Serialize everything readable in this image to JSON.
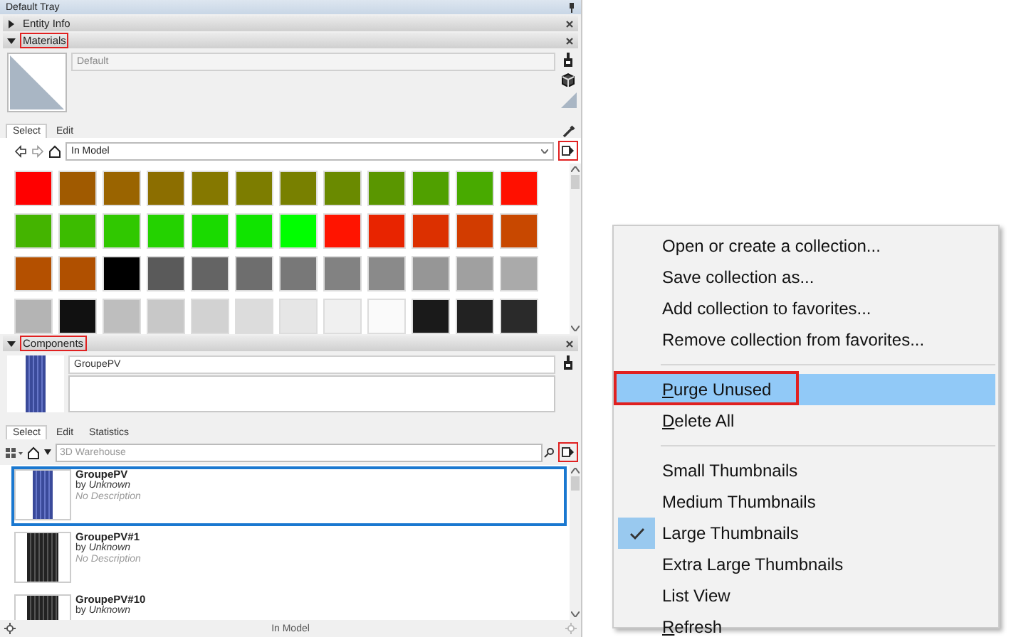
{
  "tray": {
    "title": "Default Tray"
  },
  "entity_info": {
    "title": "Entity Info",
    "expanded": false
  },
  "materials": {
    "title": "Materials",
    "expanded": true,
    "annotated": true,
    "name": "Default",
    "tabs": [
      {
        "label": "Select",
        "selected": true
      },
      {
        "label": "Edit",
        "selected": false
      }
    ],
    "collection": "In Model",
    "details_annotated": true,
    "swatches": [
      {
        "color": "#ff0000"
      },
      {
        "color": "#a05a00"
      },
      {
        "color": "#9a6400"
      },
      {
        "color": "#8c6e00"
      },
      {
        "color": "#857800"
      },
      {
        "color": "#7d7d00"
      },
      {
        "color": "#788000"
      },
      {
        "color": "#6a8a00"
      },
      {
        "color": "#5a9600"
      },
      {
        "color": "#50a000"
      },
      {
        "color": "#48aa00"
      },
      {
        "color": "#ff1000"
      },
      {
        "color": "#44b400"
      },
      {
        "color": "#3cbc00"
      },
      {
        "color": "#30c800"
      },
      {
        "color": "#24d200"
      },
      {
        "color": "#1ada00"
      },
      {
        "color": "#10e400"
      },
      {
        "color": "#00ff00"
      },
      {
        "color": "#ff1400"
      },
      {
        "color": "#e82400"
      },
      {
        "color": "#dc3000"
      },
      {
        "color": "#d23c00"
      },
      {
        "color": "#c84800"
      },
      {
        "color": "#b45000"
      },
      {
        "color": "#b05000"
      },
      {
        "color": "#000000"
      },
      {
        "color": "#5a5a5a"
      },
      {
        "color": "#646464"
      },
      {
        "color": "#6e6e6e"
      },
      {
        "color": "#787878"
      },
      {
        "color": "#828282"
      },
      {
        "color": "#8a8a8a"
      },
      {
        "color": "#969696"
      },
      {
        "color": "#a0a0a0"
      },
      {
        "color": "#aaaaaa"
      },
      {
        "color": "#b4b4b4"
      },
      {
        "color": "#111111"
      },
      {
        "color": "#bebebe"
      },
      {
        "color": "#c8c8c8"
      },
      {
        "color": "#d2d2d2"
      },
      {
        "color": "#dcdcdc"
      },
      {
        "color": "#e6e6e6"
      },
      {
        "color": "#f0f0f0"
      },
      {
        "color": "#fafafa"
      },
      {
        "color": "#1a1a1a"
      },
      {
        "color": "#222222"
      },
      {
        "color": "#2a2a2a"
      }
    ]
  },
  "components": {
    "title": "Components",
    "expanded": true,
    "annotated": true,
    "name": "GroupePV",
    "tabs": [
      {
        "label": "Select",
        "selected": true
      },
      {
        "label": "Edit",
        "selected": false
      },
      {
        "label": "Statistics",
        "selected": false
      }
    ],
    "search": {
      "placeholder": "3D Warehouse"
    },
    "details_annotated": true,
    "items": [
      {
        "name": "GroupePV",
        "author": "by *Unknown*",
        "description": "No Description",
        "kind": "blue",
        "selected": true
      },
      {
        "name": "GroupePV#1",
        "author": "by *Unknown*",
        "description": "No Description",
        "kind": "dark",
        "selected": false
      },
      {
        "name": "GroupePV#10",
        "author": "by *Unknown*",
        "kind": "dark",
        "selected": false
      }
    ],
    "footer": "In Model"
  },
  "menu": {
    "items": [
      {
        "kind": "item",
        "label": "Open or create a collection...",
        "hovered": false,
        "checked": false,
        "underline_first": false,
        "annotated": false
      },
      {
        "kind": "item",
        "label": "Save collection as...",
        "hovered": false,
        "checked": false,
        "underline_first": false,
        "annotated": false
      },
      {
        "kind": "item",
        "label": "Add collection to favorites...",
        "hovered": false,
        "checked": false,
        "underline_first": false,
        "annotated": false
      },
      {
        "kind": "item",
        "label": "Remove collection from favorites...",
        "hovered": false,
        "checked": false,
        "underline_first": false,
        "annotated": false
      },
      {
        "kind": "separator"
      },
      {
        "kind": "item",
        "label": "Purge Unused",
        "hovered": true,
        "checked": false,
        "underline_first": true,
        "annotated": true
      },
      {
        "kind": "item",
        "label": "Delete All",
        "hovered": false,
        "checked": false,
        "underline_first": true,
        "annotated": false
      },
      {
        "kind": "separator"
      },
      {
        "kind": "item",
        "label": "Small Thumbnails",
        "hovered": false,
        "checked": false,
        "underline_first": false,
        "annotated": false
      },
      {
        "kind": "item",
        "label": "Medium Thumbnails",
        "hovered": false,
        "checked": false,
        "underline_first": false,
        "annotated": false
      },
      {
        "kind": "item",
        "label": "Large Thumbnails",
        "hovered": false,
        "checked": true,
        "underline_first": false,
        "annotated": false
      },
      {
        "kind": "item",
        "label": "Extra Large Thumbnails",
        "hovered": false,
        "checked": false,
        "underline_first": false,
        "annotated": false
      },
      {
        "kind": "item",
        "label": "List View",
        "hovered": false,
        "checked": false,
        "underline_first": false,
        "annotated": false
      },
      {
        "kind": "item",
        "label": "Refresh",
        "hovered": false,
        "checked": false,
        "underline_first": true,
        "annotated": false
      }
    ]
  }
}
